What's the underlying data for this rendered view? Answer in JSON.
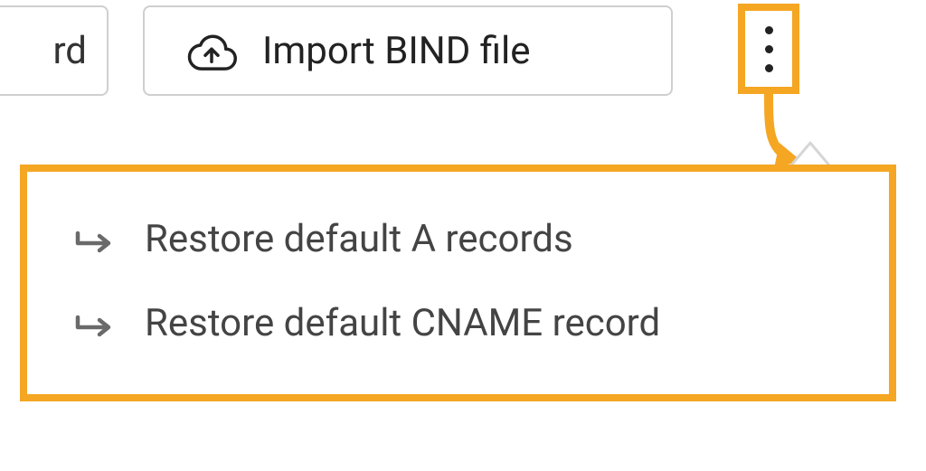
{
  "toolbar": {
    "partial_button_suffix": "rd",
    "import_label": "Import BIND file"
  },
  "dropdown": {
    "items": [
      {
        "label": "Restore default A records"
      },
      {
        "label": "Restore default CNAME record"
      }
    ]
  },
  "colors": {
    "highlight": "#f5a623",
    "border": "#cfcfcf",
    "text": "#333333"
  }
}
